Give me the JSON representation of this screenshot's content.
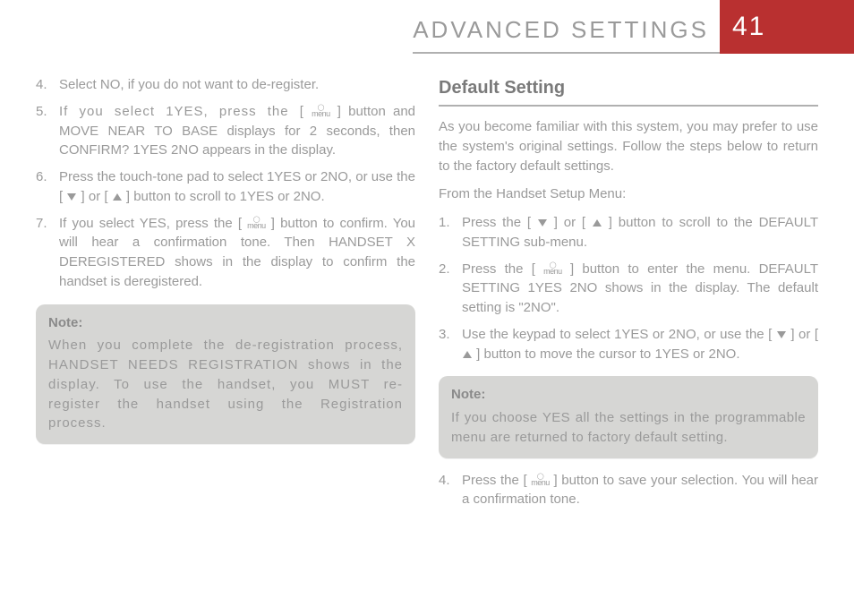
{
  "header": {
    "title": "ADVANCED SETTINGS",
    "page_number": "41"
  },
  "left": {
    "list": [
      {
        "n": "4.",
        "text_a": "Select NO, if you do not want to de-register."
      },
      {
        "n": "5.",
        "text_a": "If you select 1YES, press the [",
        "text_b": "] button and MOVE NEAR TO BASE displays for 2 seconds, then CONFIRM? 1YES 2NO appears in the display."
      },
      {
        "n": "6.",
        "text_a": "Press the touch-tone pad to select 1YES or 2NO, or use the [",
        "text_b": "] or [",
        "text_c": "] button to scroll to 1YES or 2NO."
      },
      {
        "n": "7.",
        "text_a": "If you select YES, press the [",
        "text_b": "] button to confirm. You will hear a confirmation tone. Then HANDSET X DEREGISTERED shows in the display to confirm the handset is deregistered."
      }
    ],
    "note": {
      "title": "Note:",
      "body": "When you complete the de-registration process, HANDSET NEEDS REGISTRATION shows in the display. To use the handset, you MUST re-register the handset using the Registration process."
    }
  },
  "right": {
    "section_title": "Default Setting",
    "intro": "As you become familiar with this system, you may prefer to use the system's original settings. Follow the steps below to return to the factory default settings.",
    "from_menu": "From the Handset Setup Menu:",
    "list": [
      {
        "n": "1.",
        "text_a": "Press the [",
        "text_b": "] or [",
        "text_c": "] button to scroll to the DEFAULT SETTING sub-menu."
      },
      {
        "n": "2.",
        "text_a": "Press the [",
        "text_b": "] button to enter the menu. DEFAULT SETTING 1YES 2NO shows in the display. The default setting is \"2NO\"."
      },
      {
        "n": "3.",
        "text_a": "Use the keypad to select 1YES or 2NO, or use the [",
        "text_b": "] or [",
        "text_c": "] button to move the cursor to 1YES or 2NO."
      }
    ],
    "note": {
      "title": "Note:",
      "body": "If you choose YES all the settings in the programmable menu are returned to factory default setting."
    },
    "list2": [
      {
        "n": "4.",
        "text_a": "Press the [",
        "text_b": "] button to save your selection. You will hear a confirmation tone."
      }
    ]
  },
  "icons": {
    "menu_label": "menu",
    "menu_ring": "◯"
  }
}
